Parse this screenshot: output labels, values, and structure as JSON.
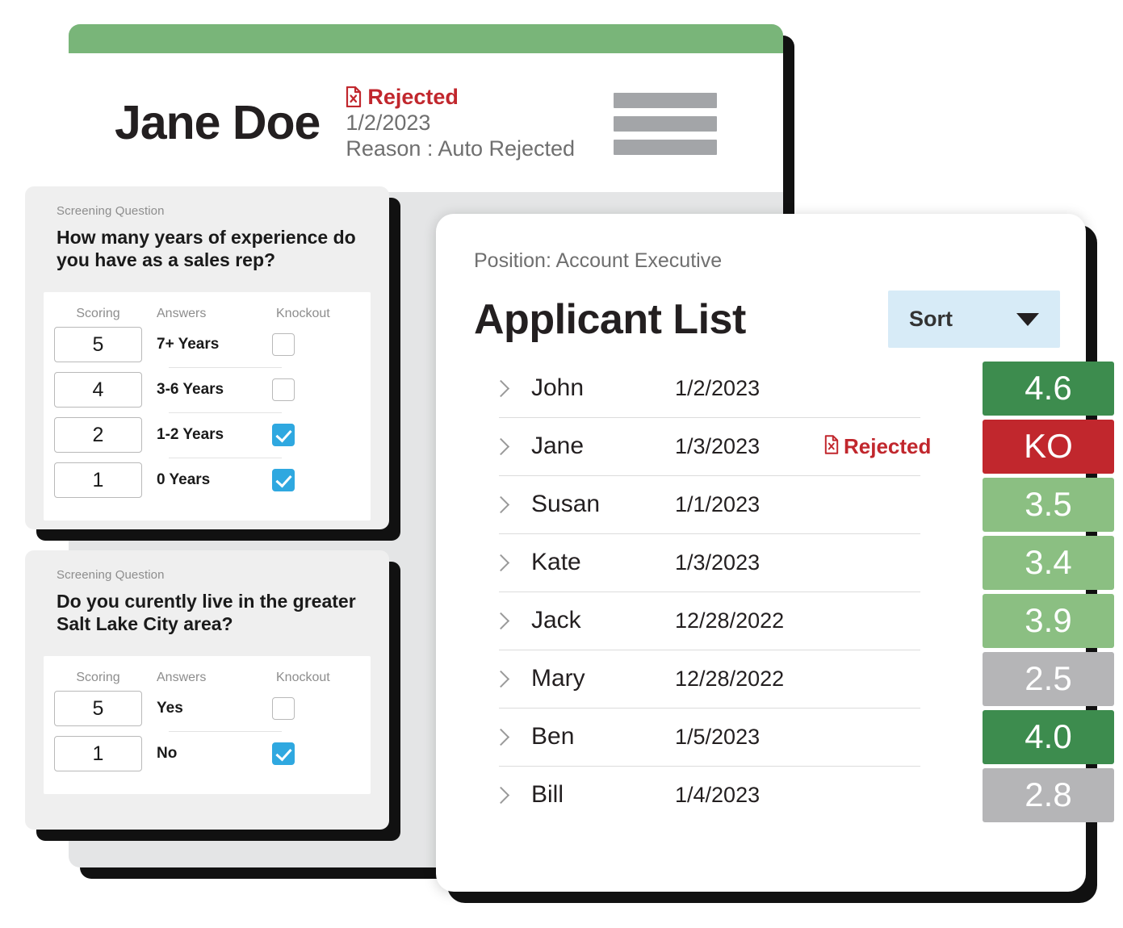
{
  "colors": {
    "header_green": "#79b579",
    "score_high": "#3d8c4e",
    "score_mid": "#8bbf82",
    "score_low": "#b5b5b7",
    "knockout_red": "#c1272d",
    "sort_blue": "#d7ebf7",
    "checkbox_blue": "#2fa8e0"
  },
  "profile": {
    "name": "Jane Doe",
    "status": "Rejected",
    "status_icon": "document-x-icon",
    "date": "1/2/2023",
    "reason": "Reason : Auto Rejected",
    "menu_icon": "hamburger-menu-icon"
  },
  "screening_questions": [
    {
      "label": "Screening Question",
      "question": "How many years of experience do you have as a sales rep?",
      "columns": {
        "scoring": "Scoring",
        "answers": "Answers",
        "knockout": "Knockout"
      },
      "rows": [
        {
          "score": "5",
          "answer": "7+ Years",
          "knockout": false
        },
        {
          "score": "4",
          "answer": "3-6 Years",
          "knockout": false
        },
        {
          "score": "2",
          "answer": "1-2 Years",
          "knockout": true
        },
        {
          "score": "1",
          "answer": "0 Years",
          "knockout": true
        }
      ]
    },
    {
      "label": "Screening Question",
      "question": "Do you curently live in the greater Salt Lake City area?",
      "columns": {
        "scoring": "Scoring",
        "answers": "Answers",
        "knockout": "Knockout"
      },
      "rows": [
        {
          "score": "5",
          "answer": "Yes",
          "knockout": false
        },
        {
          "score": "1",
          "answer": "No",
          "knockout": true
        }
      ]
    }
  ],
  "applicant_list": {
    "position": "Position: Account Executive",
    "title": "Applicant List",
    "sort_label": "Sort",
    "sort_icon": "chevron-down-icon",
    "row_expand_icon": "chevron-right-icon",
    "applicants": [
      {
        "name": "John",
        "date": "1/2/2023",
        "flag": "",
        "score": "4.6",
        "tier": "high"
      },
      {
        "name": "Jane",
        "date": "1/3/2023",
        "flag": "Rejected",
        "score": "KO",
        "tier": "ko"
      },
      {
        "name": "Susan",
        "date": "1/1/2023",
        "flag": "",
        "score": "3.5",
        "tier": "mid"
      },
      {
        "name": "Kate",
        "date": "1/3/2023",
        "flag": "",
        "score": "3.4",
        "tier": "mid"
      },
      {
        "name": "Jack",
        "date": "12/28/2022",
        "flag": "",
        "score": "3.9",
        "tier": "mid"
      },
      {
        "name": "Mary",
        "date": "12/28/2022",
        "flag": "",
        "score": "2.5",
        "tier": "low"
      },
      {
        "name": "Ben",
        "date": "1/5/2023",
        "flag": "",
        "score": "4.0",
        "tier": "high"
      },
      {
        "name": "Bill",
        "date": "1/4/2023",
        "flag": "",
        "score": "2.8",
        "tier": "low"
      }
    ]
  }
}
